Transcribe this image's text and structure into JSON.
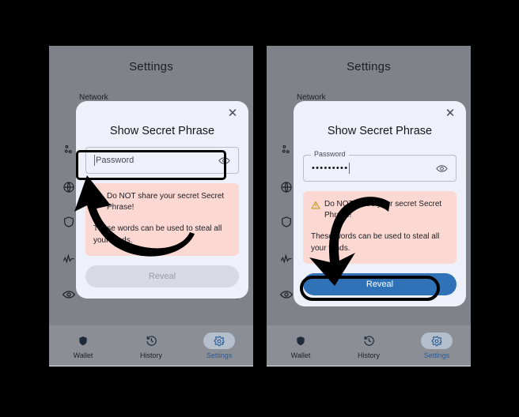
{
  "meta": {
    "colors": {
      "background": "#000000",
      "phone_backdrop": "#808289",
      "dialog_bg": "#eef1fa",
      "warning_bg": "#fcd8d3",
      "accent_blue": "#2f72b8",
      "nav_bar": "#8c8e95",
      "annotation": "#000000"
    }
  },
  "panels": [
    {
      "id": "left",
      "screen": {
        "title": "Settings",
        "section_label": "Network",
        "rows": [
          {
            "icon": "network-nodes-icon",
            "control": "chevron"
          },
          {
            "icon": "globe-icon",
            "control": "chevron"
          },
          {
            "icon": "shield-icon",
            "control": "toggle-on"
          },
          {
            "icon": "activity-icon",
            "control": "toggle-off"
          },
          {
            "icon": "eye-icon",
            "control": "chevron"
          },
          {
            "icon": "help-circle-icon",
            "control": "chevron"
          }
        ],
        "bottom_nav": [
          {
            "label": "Wallet",
            "icon": "shield-icon",
            "active": false
          },
          {
            "label": "History",
            "icon": "clock-rotate-icon",
            "active": false
          },
          {
            "label": "Settings",
            "icon": "gear-icon",
            "active": true
          }
        ]
      },
      "dialog": {
        "title": "Show Secret Phrase",
        "close_icon": "close-icon",
        "password": {
          "variant": "placeholder",
          "placeholder": "Password",
          "value": "",
          "float_label": "",
          "eye_icon": "eye-icon"
        },
        "warning": {
          "icon": "warning-triangle-icon",
          "strong": "Do NOT share your secret Secret Phrase!",
          "body": "These words can be used to steal all your funds."
        },
        "reveal": {
          "label": "Reveal",
          "enabled": false
        }
      },
      "annotation": {
        "target": "password-field",
        "arrow": "curved-arrow-pointing-up-left"
      }
    },
    {
      "id": "right",
      "screen": {
        "title": "Settings",
        "section_label": "Network",
        "rows": [
          {
            "icon": "network-nodes-icon",
            "control": "chevron"
          },
          {
            "icon": "globe-icon",
            "control": "chevron"
          },
          {
            "icon": "shield-icon",
            "control": "toggle-on"
          },
          {
            "icon": "activity-icon",
            "control": "toggle-off"
          },
          {
            "icon": "eye-icon",
            "control": "chevron"
          },
          {
            "icon": "help-circle-icon",
            "control": "chevron"
          }
        ],
        "bottom_nav": [
          {
            "label": "Wallet",
            "icon": "shield-icon",
            "active": false
          },
          {
            "label": "History",
            "icon": "clock-rotate-icon",
            "active": false
          },
          {
            "label": "Settings",
            "icon": "gear-icon",
            "active": true
          }
        ]
      },
      "dialog": {
        "title": "Show Secret Phrase",
        "close_icon": "close-icon",
        "password": {
          "variant": "filled",
          "placeholder": "Password",
          "value": "•••••••••",
          "float_label": "Password",
          "eye_icon": "eye-icon"
        },
        "warning": {
          "icon": "warning-triangle-icon",
          "strong": "Do NOT share your secret Secret Phrase!",
          "body": "These words can be used to steal all your funds."
        },
        "reveal": {
          "label": "Reveal",
          "enabled": true
        }
      },
      "annotation": {
        "target": "reveal-button",
        "arrow": "curved-arrow-pointing-down"
      }
    }
  ]
}
